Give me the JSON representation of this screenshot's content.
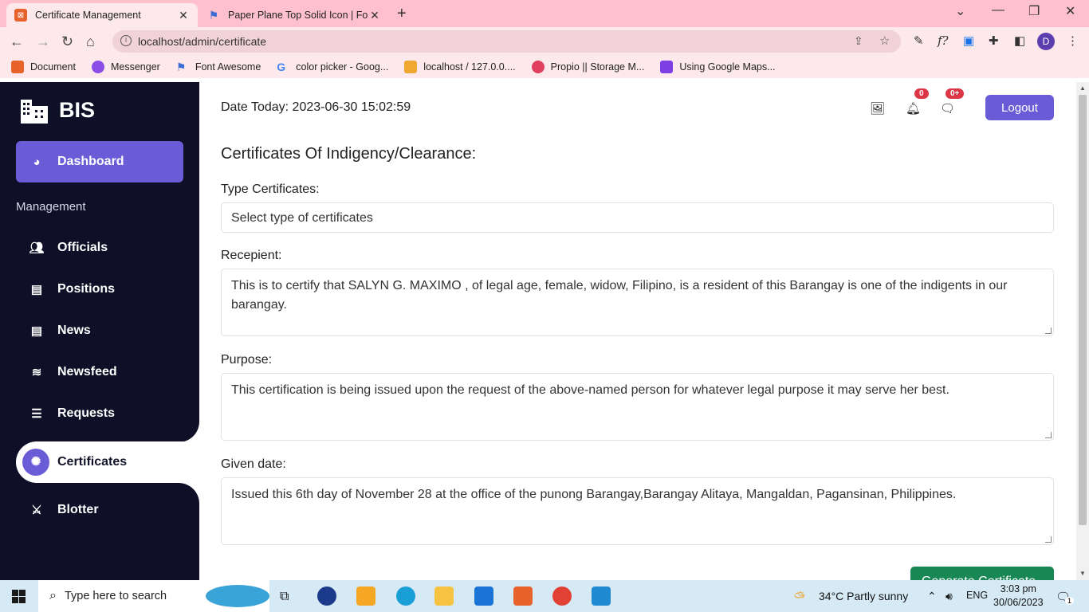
{
  "browser": {
    "tabs": [
      {
        "title": "Certificate Management",
        "active": true
      },
      {
        "title": "Paper Plane Top Solid Icon | Font",
        "active": false
      }
    ],
    "url": "localhost/admin/certificate",
    "bookmarks": [
      "Document",
      "Messenger",
      "Font Awesome",
      "color picker - Goog...",
      "localhost / 127.0.0....",
      "Propio || Storage M...",
      "Using Google Maps..."
    ],
    "profile_initial": "D"
  },
  "sidebar": {
    "brand": "BIS",
    "dashboard": "Dashboard",
    "section_label": "Management",
    "items": [
      "Officials",
      "Positions",
      "News",
      "Newsfeed",
      "Requests",
      "Certificates",
      "Blotter"
    ],
    "active_item": "Certificates"
  },
  "header": {
    "date": "Date Today: 2023-06-30 15:02:59",
    "notif_badge": "0",
    "message_badge": "0+",
    "logout": "Logout"
  },
  "form": {
    "heading": "Certificates Of Indigency/Clearance:",
    "type_label": "Type Certificates:",
    "type_value": "Select type of certificates",
    "recipient_label": "Recepient:",
    "recipient_value": "This is to certify that SALYN G. MAXIMO , of legal age, female, widow, Filipino, is a resident of this Barangay is one of the indigents in our barangay.",
    "purpose_label": "Purpose:",
    "purpose_value": "This certification is being issued upon the request of the above-named person for whatever legal purpose it may serve her best.",
    "date_label": "Given date:",
    "date_value": "Issued this 6th day of November 28 at the office of the punong Barangay,Barangay Alitaya, Mangaldan, Pagansinan, Philippines.",
    "generate_button": "Generate Certificate"
  },
  "taskbar": {
    "search_placeholder": "Type here to search",
    "weather": "34°C  Partly sunny",
    "language": "ENG",
    "time": "3:03 pm",
    "date": "30/06/2023",
    "notifications": "1"
  },
  "colors": {
    "tab_bar": "#fdc0cc",
    "sidebar": "#0f0f28",
    "accent": "#6a5bd6",
    "generate": "#198754"
  }
}
